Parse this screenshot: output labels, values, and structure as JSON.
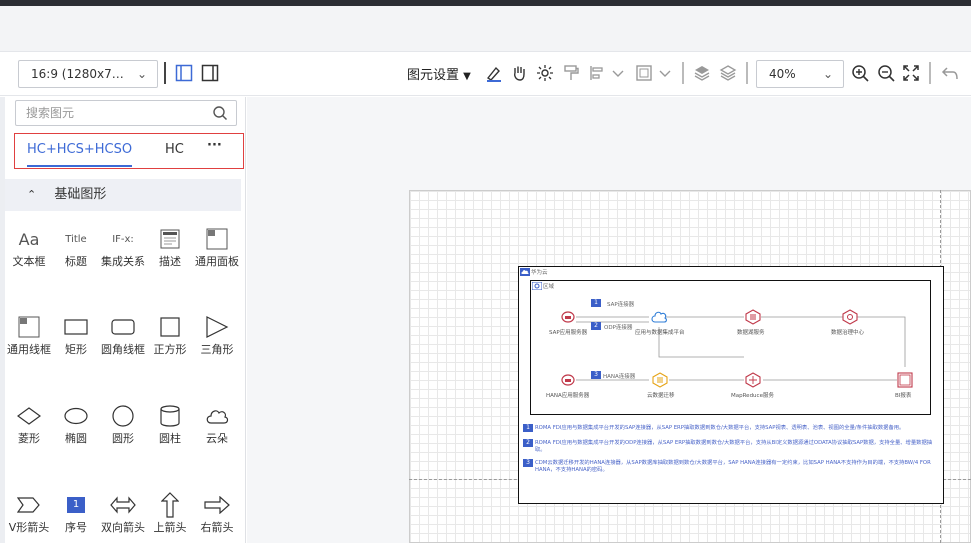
{
  "toolbar": {
    "page_size": "16:9 (1280x7…",
    "element_settings": "图元设置",
    "zoom": "40%"
  },
  "sidebar": {
    "search_placeholder": "搜索图元",
    "tabs": [
      "HC+HCS+HCSO",
      "HC",
      "···"
    ],
    "section_title": "基础图形",
    "shapes": [
      {
        "icon": "Aa",
        "label": "文本框"
      },
      {
        "icon": "Title",
        "label": "标题"
      },
      {
        "icon": "IF-x:",
        "label": "集成关系"
      },
      {
        "icon": "desc-icon",
        "label": "描述"
      },
      {
        "icon": "panel-icon",
        "label": "通用面板"
      },
      {
        "icon": "frame-icon",
        "label": "通用线框"
      },
      {
        "icon": "rect-icon",
        "label": "矩形"
      },
      {
        "icon": "round-rect-icon",
        "label": "圆角线框"
      },
      {
        "icon": "square-icon",
        "label": "正方形"
      },
      {
        "icon": "triangle-icon",
        "label": "三角形"
      },
      {
        "icon": "diamond-icon",
        "label": "菱形"
      },
      {
        "icon": "ellipse-icon",
        "label": "椭圆"
      },
      {
        "icon": "circle-icon",
        "label": "圆形"
      },
      {
        "icon": "cylinder-icon",
        "label": "圆柱"
      },
      {
        "icon": "cloud-icon",
        "label": "云朵"
      },
      {
        "icon": "chevron-arrow-icon",
        "label": "V形箭头"
      },
      {
        "icon": "1",
        "label": "序号"
      },
      {
        "icon": "double-arrow-icon",
        "label": "双向箭头"
      },
      {
        "icon": "up-arrow-icon",
        "label": "上箭头"
      },
      {
        "icon": "right-arrow-icon",
        "label": "右箭头"
      }
    ]
  },
  "diagram": {
    "cloud_label": "华为云",
    "region_label": "区域",
    "nodes": {
      "sap_server": "SAP应用服务器",
      "integration_platform": "应用与数据集成平台",
      "data_lake": "数据湖服务",
      "data_governance": "数据治理中心",
      "hana_server": "HANA应用服务器",
      "migration": "云数据迁移",
      "mapreduce": "MapReduce服务",
      "bi": "BI报表"
    },
    "connectors": {
      "c1": "SAP连接器",
      "c2": "ODP连接器",
      "c3": "HANA连接器"
    },
    "badges": [
      "1",
      "2",
      "3"
    ],
    "descriptions": [
      "ROMA FDI应用与数据集成平台开发的SAP连接器，从SAP ERP抽取数据到数仓/大数据平台，支持SAP视表、透明表、池表、视图的全量/条件抽取数据备用。",
      "ROMA FDI应用与数据集成平台开发的ODP连接器，从SAP ERP抽取数据到数仓/大数据平台，支持从BI定义数据源通过ODATA协议抽取SAP数据，支持全量、增量数据抽取。",
      "CDM云数据迁移开发的HANA连接器，从SAP数据库抽取数据到数仓/大数据平台，SAP HANA连接器有一定约束，比如SAP HANA不支持作为目的端，不支持BW/4 FOR HANA，不支持HANA的密码。"
    ]
  }
}
